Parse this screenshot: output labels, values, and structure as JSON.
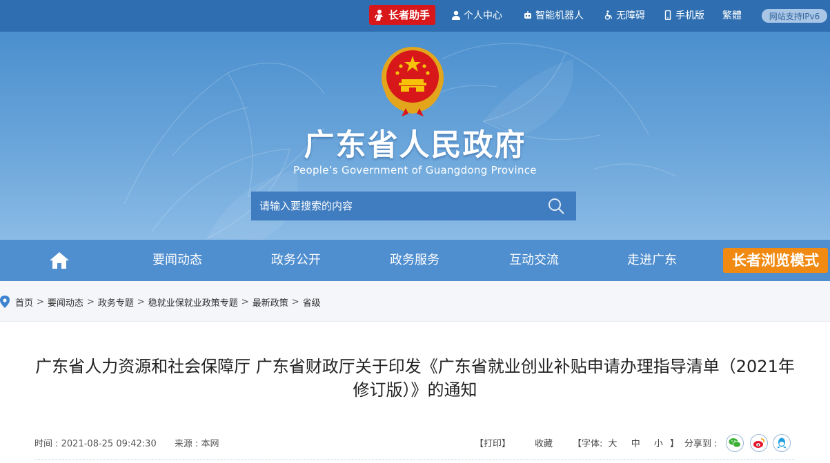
{
  "topbar": {
    "elder_helper": "长者助手",
    "personal_center": "个人中心",
    "robot": "智能机器人",
    "accessibility": "无障碍",
    "mobile": "手机版",
    "traditional": "繁體",
    "ipv6": "网站支持IPv6"
  },
  "header": {
    "title": "广东省人民政府",
    "subtitle": "People’s Government of Guangdong Province",
    "search_placeholder": "请输入要搜索的内容"
  },
  "nav": {
    "items": [
      {
        "label": "要闻动态"
      },
      {
        "label": "政务公开"
      },
      {
        "label": "政务服务"
      },
      {
        "label": "互动交流"
      },
      {
        "label": "走进广东"
      }
    ],
    "elder_mode": "长者浏览模式"
  },
  "breadcrumb": [
    "首页",
    "要闻动态",
    "政务专题",
    "稳就业保就业政策专题",
    "最新政策",
    "省级"
  ],
  "article": {
    "title_line1": "广东省人力资源和社会保障厅 广东省财政厅关于印发《广东省就业创业补贴申请办理指导清单（2021年",
    "title_line2": "修订版）》的通知",
    "time": "时间 : 2021-08-25 09:42:30",
    "source": "来源 : 本网",
    "print": "【打印】",
    "favorite": "收藏",
    "font_open": "【字体:",
    "font_large": "大",
    "font_medium": "中",
    "font_small": "小",
    "font_close": "】",
    "share_label": "分享到 :"
  },
  "colors": {
    "topbar": "#2f6fb1",
    "nav": "#4f8ecf",
    "elder_helper": "#d8171a",
    "elder_mode": "#f08a12"
  },
  "icons": [
    "user-icon",
    "robot-icon",
    "wheelchair-icon",
    "phone-icon",
    "search-icon",
    "home-icon",
    "location-pin-icon",
    "wechat-icon",
    "weibo-icon",
    "qq-icon"
  ]
}
